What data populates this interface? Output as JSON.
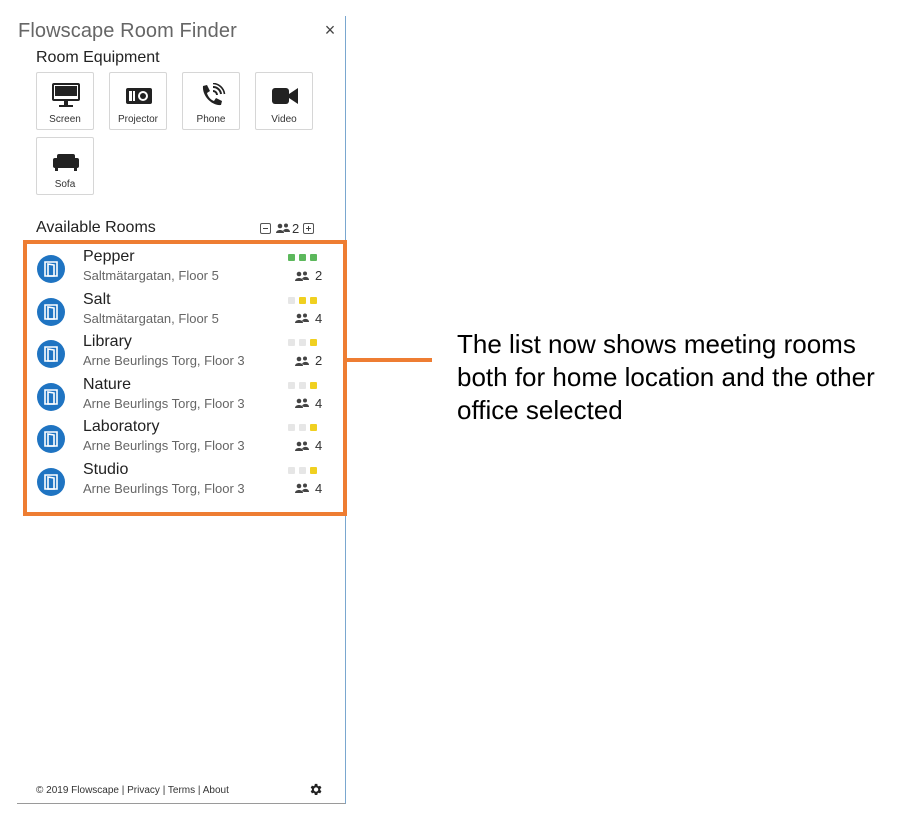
{
  "app": {
    "title": "Flowscape Room Finder",
    "close_glyph": "×"
  },
  "equipment": {
    "title": "Room Equipment",
    "items": [
      {
        "label": "Screen",
        "icon": "monitor-icon"
      },
      {
        "label": "Projector",
        "icon": "projector-icon"
      },
      {
        "label": "Phone",
        "icon": "phone-icon"
      },
      {
        "label": "Video",
        "icon": "video-camera-icon"
      },
      {
        "label": "Sofa",
        "icon": "sofa-icon"
      }
    ]
  },
  "available_rooms": {
    "title": "Available Rooms",
    "capacity_filter": "2",
    "rooms": [
      {
        "name": "Pepper",
        "address": "Saltmätargatan, Floor 5",
        "capacity": "2",
        "availability": [
          "green",
          "green",
          "green"
        ]
      },
      {
        "name": "Salt",
        "address": "Saltmätargatan, Floor 5",
        "capacity": "4",
        "availability": [
          "empty",
          "yellow",
          "yellow"
        ]
      },
      {
        "name": "Library",
        "address": "Arne Beurlings Torg, Floor 3",
        "capacity": "2",
        "availability": [
          "empty",
          "empty",
          "yellow"
        ]
      },
      {
        "name": "Nature",
        "address": "Arne Beurlings Torg, Floor 3",
        "capacity": "4",
        "availability": [
          "empty",
          "empty",
          "yellow"
        ]
      },
      {
        "name": "Laboratory",
        "address": "Arne Beurlings Torg, Floor 3",
        "capacity": "4",
        "availability": [
          "empty",
          "empty",
          "yellow"
        ]
      },
      {
        "name": "Studio",
        "address": "Arne Beurlings Torg, Floor 3",
        "capacity": "4",
        "availability": [
          "empty",
          "empty",
          "yellow"
        ]
      }
    ]
  },
  "footer": {
    "copyright": "© 2019 Flowscape",
    "separator": " | ",
    "links": [
      "Privacy",
      "Terms",
      "About"
    ]
  },
  "colors": {
    "accent": "#1f74c2",
    "highlight": "#ee7d32",
    "green": "#5cb85c",
    "yellow": "#f0d020",
    "empty": "#e6e6e6"
  },
  "annotation": {
    "text": "The list now shows meeting rooms both for home location and the other office selected"
  }
}
